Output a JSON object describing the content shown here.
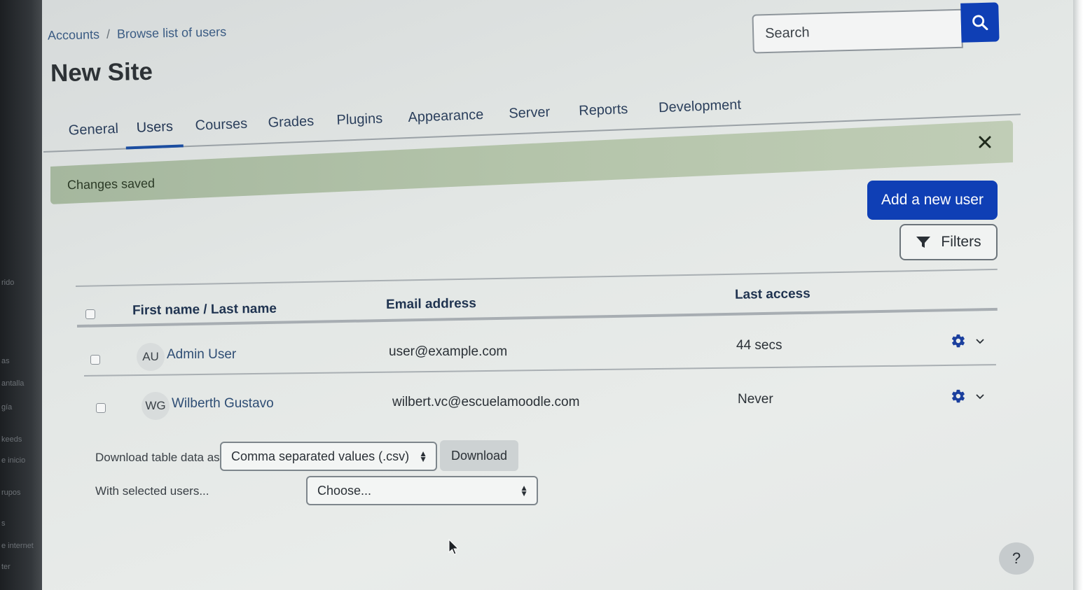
{
  "breadcrumb": {
    "item1": "Accounts",
    "separator": "/",
    "item2": "Browse list of users"
  },
  "page_title": "New Site",
  "search": {
    "placeholder": "Search",
    "button_icon": "search-icon"
  },
  "tabs": [
    {
      "label": "General"
    },
    {
      "label": "Users",
      "active": true
    },
    {
      "label": "Courses"
    },
    {
      "label": "Grades"
    },
    {
      "label": "Plugins"
    },
    {
      "label": "Appearance"
    },
    {
      "label": "Server"
    },
    {
      "label": "Reports"
    },
    {
      "label": "Development"
    }
  ],
  "alert": {
    "message": "Changes saved",
    "close_icon": "close-icon"
  },
  "actions": {
    "add_user": "Add a new user",
    "filters": "Filters",
    "filter_icon": "funnel-icon"
  },
  "table": {
    "headers": {
      "name": "First name / Last name",
      "email": "Email address",
      "last_access": "Last access"
    },
    "rows": [
      {
        "initials": "AU",
        "name": "Admin User",
        "email": "user@example.com",
        "last_access": "44 secs"
      },
      {
        "initials": "WG",
        "name": "Wilberth Gustavo",
        "email": "wilbert.vc@escuelamoodle.com",
        "last_access": "Never"
      }
    ]
  },
  "download": {
    "label": "Download table data as",
    "format": "Comma separated values (.csv)",
    "button": "Download"
  },
  "bulk": {
    "label": "With selected users...",
    "choose": "Choose..."
  },
  "help": {
    "label": "?"
  },
  "colors": {
    "primary": "#0f3fb5",
    "alert_bg": "#b4c4aa",
    "link": "#2e4d74"
  }
}
